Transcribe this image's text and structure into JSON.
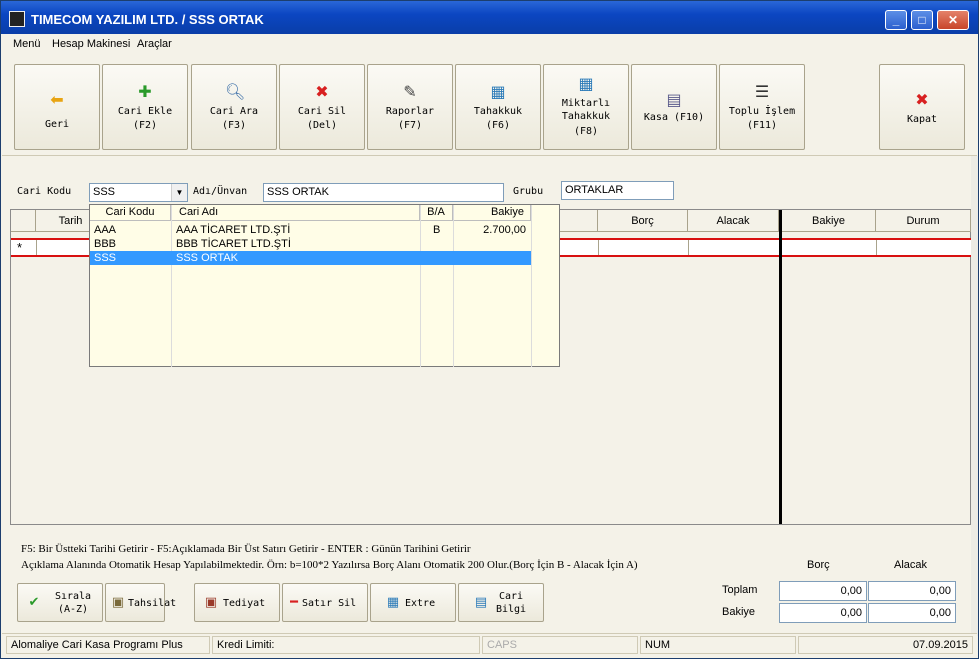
{
  "window": {
    "title": "TIMECOM YAZILIM LTD. / SSS ORTAK"
  },
  "menu": [
    "Menü",
    "Hesap Makinesi",
    "Araçlar"
  ],
  "toolbar": [
    {
      "label": "Geri",
      "sub": "",
      "icon": "arrow-left-icon"
    },
    {
      "label": "Cari Ekle",
      "sub": "(F2)",
      "icon": "plus-icon"
    },
    {
      "label": "Cari Ara",
      "sub": "(F3)",
      "icon": "search-icon"
    },
    {
      "label": "Cari Sil",
      "sub": "(Del)",
      "icon": "delete-icon"
    },
    {
      "label": "Raporlar",
      "sub": "(F7)",
      "icon": "report-icon"
    },
    {
      "label": "Tahakkuk",
      "sub": "(F6)",
      "icon": "accrual-icon"
    },
    {
      "label": "Miktarlı Tahakkuk",
      "sub": "(F8)",
      "icon": "quantity-accrual-icon"
    },
    {
      "label": "Kasa (F10)",
      "sub": "",
      "icon": "cash-register-icon"
    },
    {
      "label": "Toplu İşlem",
      "sub": "(F11)",
      "icon": "batch-list-icon"
    },
    {
      "label": "Kapat",
      "sub": "",
      "icon": "close-icon"
    }
  ],
  "form": {
    "cari_kodu_label": "Cari Kodu",
    "cari_kodu_value": "SSS",
    "adi_label": "Adı/Ünvan",
    "adi_value": "SSS ORTAK",
    "grubu_label": "Grubu",
    "grubu_value": "ORTAKLAR"
  },
  "grid": {
    "columns": [
      "Tarih",
      "Borç",
      "Alacak",
      "Bakiye",
      "Durum"
    ],
    "new_row_marker": "*"
  },
  "dropdown": {
    "columns": [
      "Cari Kodu",
      "Cari Adı",
      "B/A",
      "Bakiye"
    ],
    "rows": [
      {
        "code": "AAA",
        "name": "AAA TİCARET LTD.ŞTİ",
        "ba": "B",
        "balance": "2.700,00",
        "selected": false
      },
      {
        "code": "BBB",
        "name": "BBB TİCARET LTD.ŞTİ",
        "ba": "",
        "balance": "",
        "selected": false
      },
      {
        "code": "SSS",
        "name": "SSS ORTAK",
        "ba": "",
        "balance": "",
        "selected": true
      }
    ]
  },
  "info": {
    "line1": "F5: Bir Üstteki Tarihi Getirir - F5:Açıklamada Bir Üst Satırı Getirir - ENTER : Günün Tarihini Getirir",
    "line2": "Açıklama Alanında Otomatik Hesap Yapılabilmektedir. Örn: b=100*2 Yazılırsa Borç Alanı Otomatik 200 Olur.(Borç İçin B  -  Alacak İçin A)"
  },
  "bottom_buttons": [
    {
      "label": "Sırala",
      "sub": "(A-Z)",
      "icon": "check-icon"
    },
    {
      "label": "Tahsilat",
      "sub": "",
      "icon": "collection-icon"
    },
    {
      "label": "Tediyat",
      "sub": "",
      "icon": "payment-icon"
    },
    {
      "label": "Satır Sil",
      "sub": "",
      "icon": "delete-row-icon"
    },
    {
      "label": "Extre",
      "sub": "",
      "icon": "statement-icon"
    },
    {
      "label": "Cari",
      "sub": "Bilgi",
      "icon": "info-icon"
    }
  ],
  "totals": {
    "borc_label": "Borç",
    "alacak_label": "Alacak",
    "toplam_label": "Toplam",
    "bakiye_label": "Bakiye",
    "toplam_borc": "0,00",
    "toplam_alacak": "0,00",
    "bakiye_borc": "0,00",
    "bakiye_alacak": "0,00"
  },
  "status": {
    "app": "Alomaliye Cari Kasa Programı Plus",
    "credit": "Kredi Limiti:",
    "caps": "CAPS",
    "num": "NUM",
    "date": "07.09.2015"
  }
}
